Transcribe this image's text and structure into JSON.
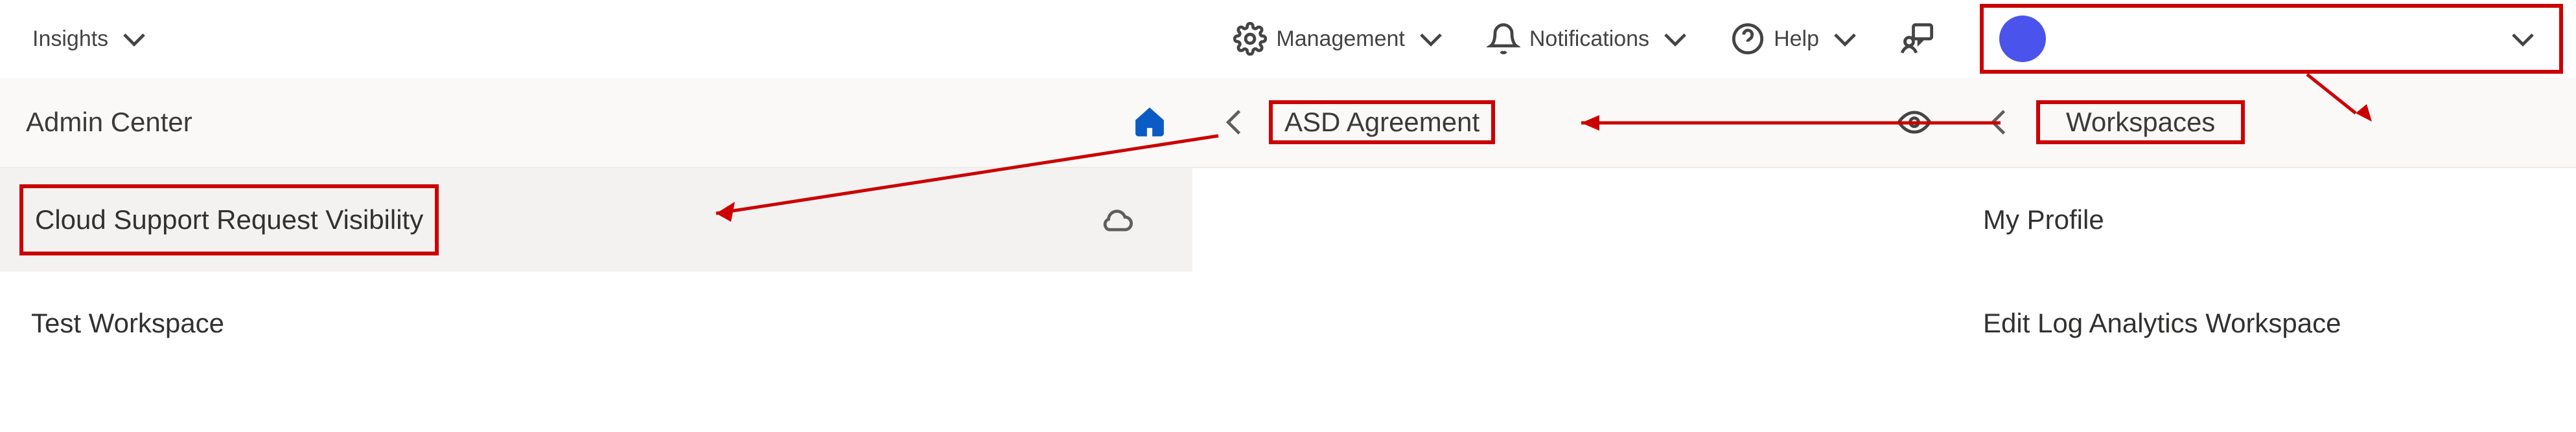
{
  "topbar": {
    "insights_label": "Insights",
    "management_label": "Management",
    "notifications_label": "Notifications",
    "help_label": "Help"
  },
  "left_panel": {
    "header": "Admin Center",
    "highlighted_item": "Cloud Support Request Visibility",
    "item_below": "Test Workspace"
  },
  "mid_panel": {
    "header": "ASD Agreement"
  },
  "right_panel": {
    "header": "Workspaces",
    "item1": "My Profile",
    "item2": "Edit Log Analytics Workspace"
  }
}
